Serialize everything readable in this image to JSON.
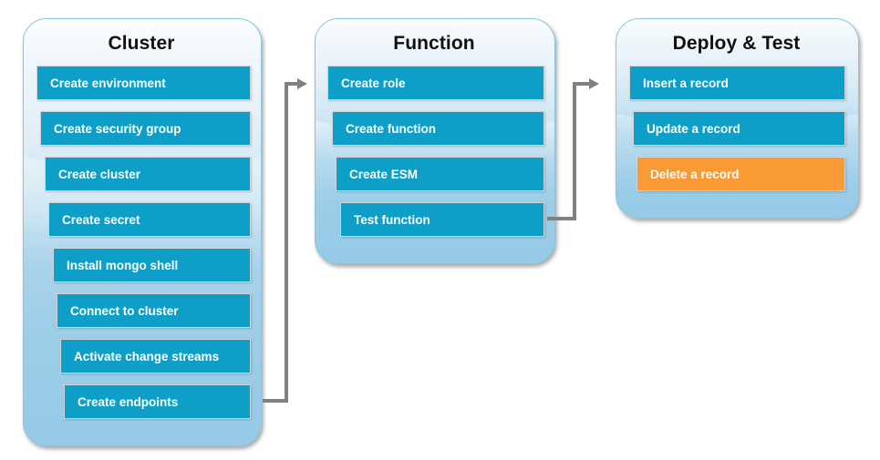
{
  "diagram": {
    "title": "Cluster / Function / Deploy & Test workflow",
    "colors": {
      "task_blue": "#0d9fc8",
      "task_orange": "#fa9a35",
      "panel_top": "#fbfdfe",
      "panel_bottom": "#96cae7",
      "connector_gray": "#808080",
      "title_text": "#10100f",
      "task_text": "#ffffff"
    },
    "groups": [
      {
        "id": "cluster",
        "title": "Cluster",
        "tasks": [
          {
            "label": "Create environment",
            "accent": "blue"
          },
          {
            "label": "Create security group",
            "accent": "blue"
          },
          {
            "label": "Create cluster",
            "accent": "blue"
          },
          {
            "label": "Create secret",
            "accent": "blue"
          },
          {
            "label": "Install mongo shell",
            "accent": "blue"
          },
          {
            "label": "Connect to cluster",
            "accent": "blue"
          },
          {
            "label": "Activate change streams",
            "accent": "blue"
          },
          {
            "label": "Create endpoints",
            "accent": "blue"
          }
        ]
      },
      {
        "id": "function",
        "title": "Function",
        "tasks": [
          {
            "label": "Create role",
            "accent": "blue"
          },
          {
            "label": "Create function",
            "accent": "blue"
          },
          {
            "label": "Create ESM",
            "accent": "blue"
          },
          {
            "label": "Test function",
            "accent": "blue"
          }
        ]
      },
      {
        "id": "deploy-test",
        "title": "Deploy & Test",
        "tasks": [
          {
            "label": "Insert a record",
            "accent": "blue"
          },
          {
            "label": "Update a record",
            "accent": "blue"
          },
          {
            "label": "Delete a record",
            "accent": "orange"
          }
        ]
      }
    ],
    "connectors": [
      {
        "id": "cluster-to-function",
        "from": "cluster",
        "to": "function"
      },
      {
        "id": "function-to-deploy-test",
        "from": "function",
        "to": "deploy-test"
      }
    ]
  }
}
